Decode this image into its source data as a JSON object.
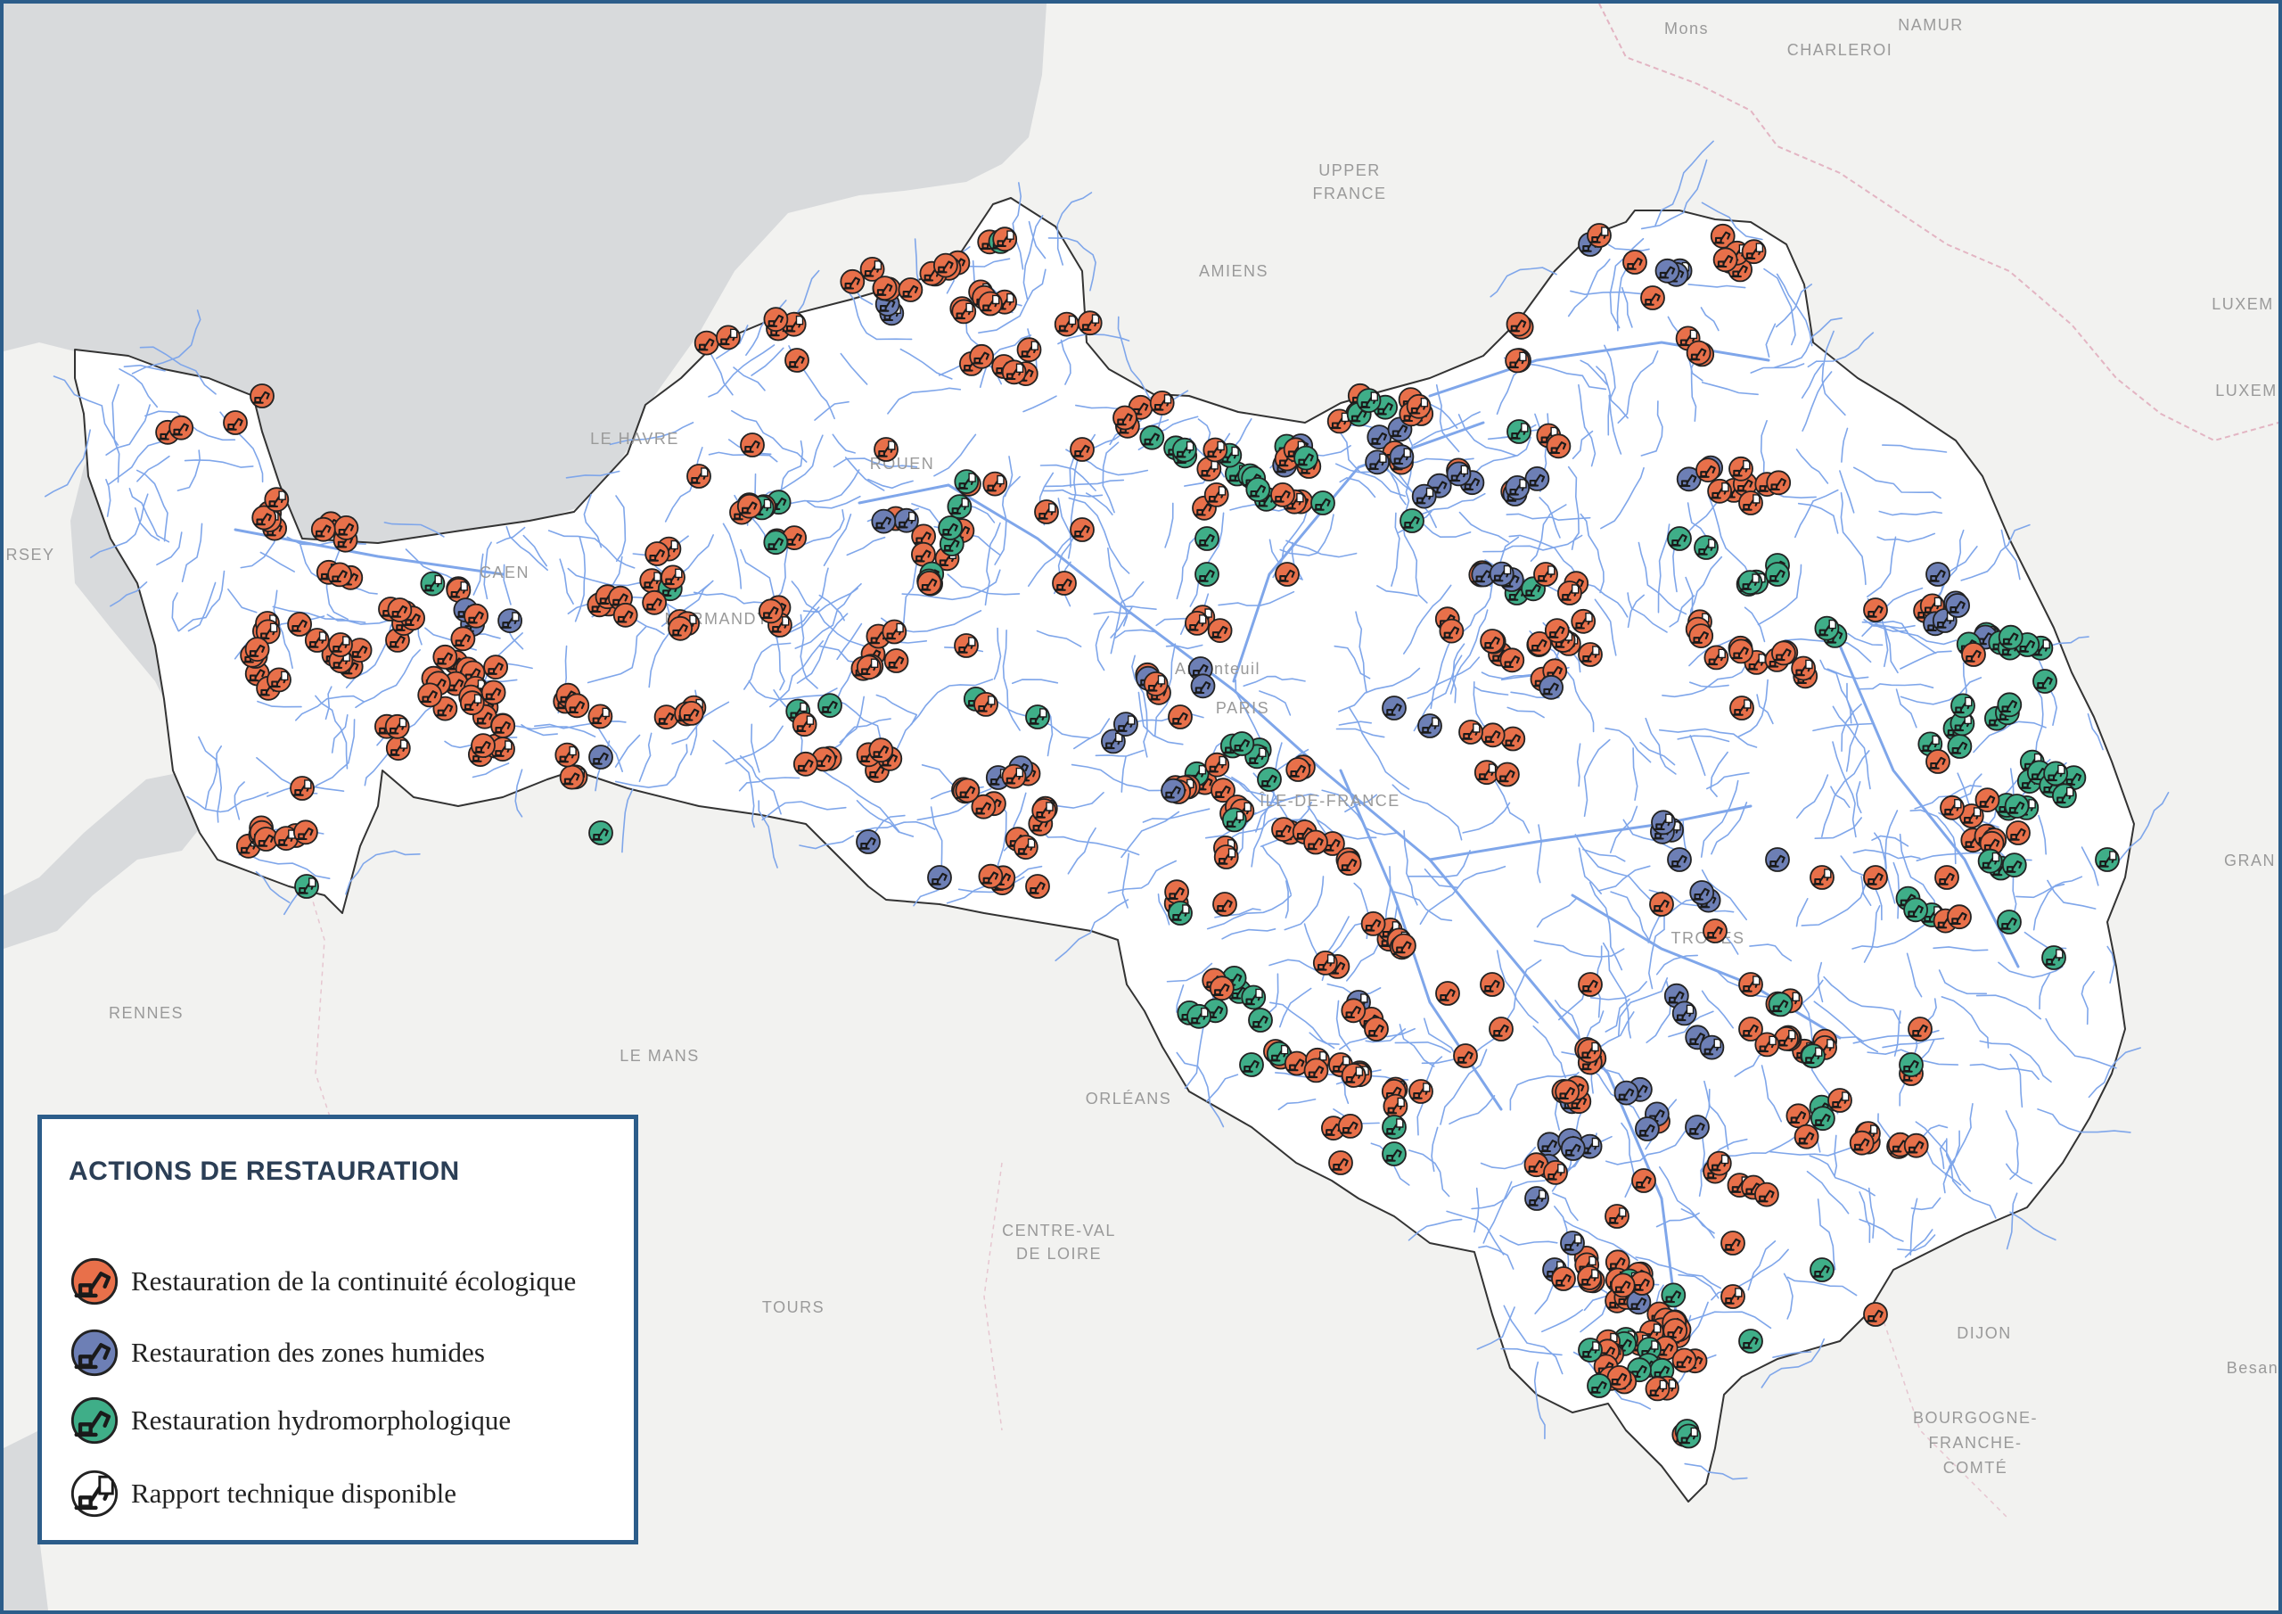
{
  "map": {
    "colors": {
      "sea": "#d8dadc",
      "land": "#f2f2f0",
      "basin": "#ffffff",
      "basin_border": "#333333",
      "river": "#7fa6ea",
      "continuite": "#e8704a",
      "zones_humides": "#6d7fb5",
      "hydromorpho": "#3fae88"
    },
    "places": [
      {
        "id": "mons",
        "label": "Mons"
      },
      {
        "id": "namur",
        "label": "NAMUR"
      },
      {
        "id": "charleroi",
        "label": "CHARLEROI"
      },
      {
        "id": "upper",
        "label": "UPPER"
      },
      {
        "id": "france",
        "label": "FRANCE"
      },
      {
        "id": "amiens",
        "label": "AMIENS"
      },
      {
        "id": "luxem1",
        "label": "LUXEM"
      },
      {
        "id": "luxem2",
        "label": "LUXEM"
      },
      {
        "id": "lehavre",
        "label": "LE HAVRE"
      },
      {
        "id": "rouen",
        "label": "ROUEN"
      },
      {
        "id": "rsey",
        "label": "RSEY"
      },
      {
        "id": "caen",
        "label": "CAEN"
      },
      {
        "id": "normandy",
        "label": "NORMANDY"
      },
      {
        "id": "argenteuil",
        "label": "Argenteuil"
      },
      {
        "id": "paris",
        "label": "PARIS"
      },
      {
        "id": "iledefrance",
        "label": "ÎLE-DE-FRANCE"
      },
      {
        "id": "troyes",
        "label": "TROYES"
      },
      {
        "id": "gran",
        "label": "GRAN"
      },
      {
        "id": "rennes",
        "label": "RENNES"
      },
      {
        "id": "lemans",
        "label": "LE MANS"
      },
      {
        "id": "orleans",
        "label": "ORLÉANS"
      },
      {
        "id": "cvl1",
        "label": "CENTRE-VAL"
      },
      {
        "id": "cvl2",
        "label": "DE LOIRE"
      },
      {
        "id": "tours",
        "label": "TOURS"
      },
      {
        "id": "dijon",
        "label": "DIJON"
      },
      {
        "id": "besancon",
        "label": "Besanço"
      },
      {
        "id": "bfc1",
        "label": "BOURGOGNE-"
      },
      {
        "id": "bfc2",
        "label": "FRANCHE-"
      },
      {
        "id": "bfc3",
        "label": "COMTÉ"
      }
    ]
  },
  "legend": {
    "title": "ACTIONS DE RESTAURATION",
    "items": [
      {
        "id": "continuite",
        "label": "Restauration de la continuité écologique",
        "icon": "excavator-icon",
        "color": "#e8704a"
      },
      {
        "id": "zones_humides",
        "label": "Restauration des zones humides",
        "icon": "excavator-icon",
        "color": "#6d7fb5"
      },
      {
        "id": "hydromorpho",
        "label": "Restauration hydromorphologique",
        "icon": "excavator-icon",
        "color": "#3fae88"
      },
      {
        "id": "rapport",
        "label": "Rapport technique disponible",
        "icon": "excavator-document-icon",
        "color": "#ffffff"
      }
    ]
  }
}
